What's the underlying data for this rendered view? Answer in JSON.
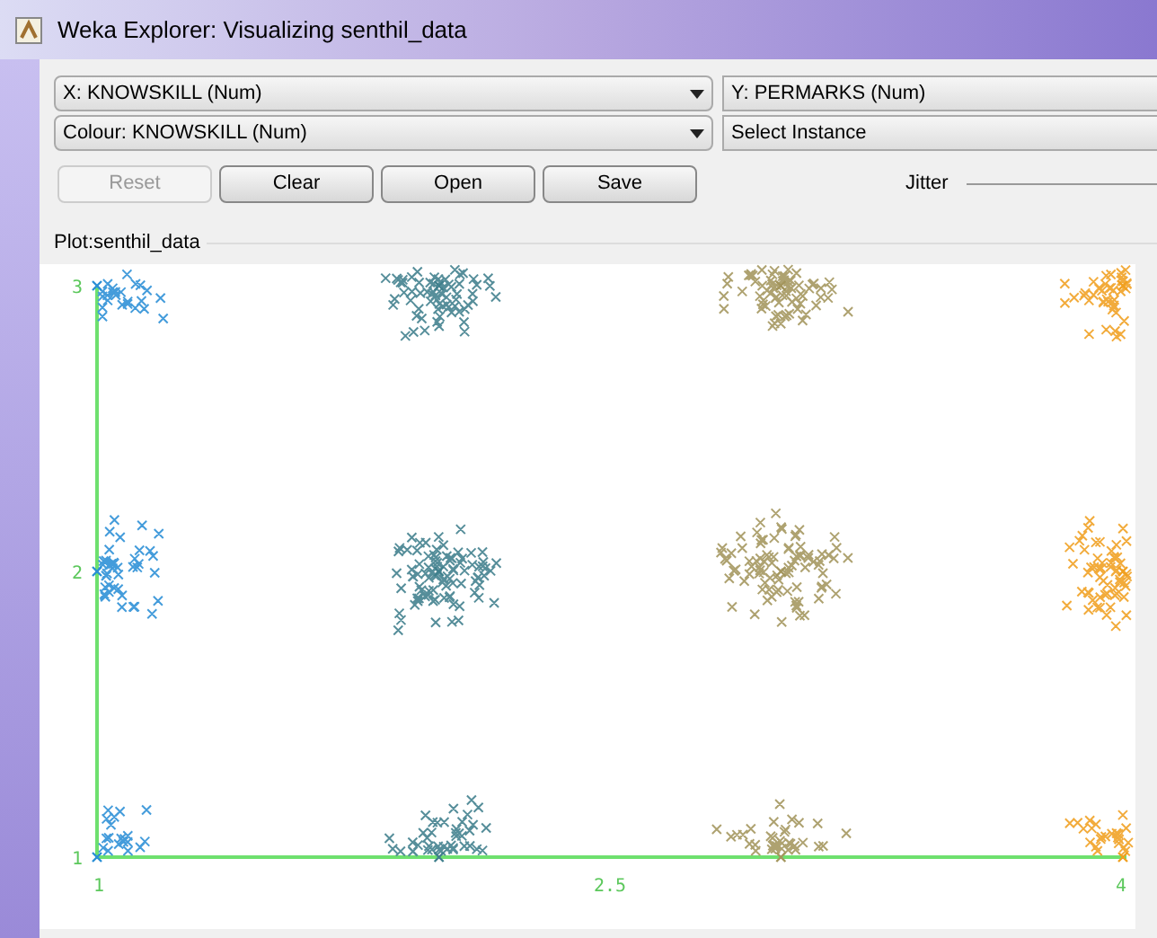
{
  "window": {
    "title": "Weka Explorer: Visualizing senthil_data"
  },
  "x_select": {
    "value": "X: KNOWSKILL (Num)"
  },
  "y_select": {
    "value": "Y: PERMARKS (Num)"
  },
  "colour_select": {
    "value": "Colour: KNOWSKILL (Num)"
  },
  "instance_select": {
    "value": "Select Instance"
  },
  "buttons": [
    {
      "label": "Reset",
      "disabled": true
    },
    {
      "label": "Clear",
      "disabled": false
    },
    {
      "label": "Open",
      "disabled": false
    },
    {
      "label": "Save",
      "disabled": false
    }
  ],
  "jitter": {
    "label": "Jitter"
  },
  "plot": {
    "title": "Plot:senthil_data",
    "chart_data": {
      "type": "scatter",
      "xlim": [
        1,
        4
      ],
      "ylim": [
        1,
        3
      ],
      "xticks": [
        1,
        2.5,
        4
      ],
      "yticks": [
        1,
        2,
        3
      ],
      "series": [
        {
          "color": "#2a8fd6",
          "x": [
            1,
            1,
            1
          ],
          "values": [
            1,
            2,
            3
          ]
        },
        {
          "color": "#3f7f8c",
          "x": [
            2,
            2,
            2
          ],
          "values": [
            1,
            2,
            3
          ]
        },
        {
          "color": "#a3955c",
          "x": [
            3,
            3,
            3
          ],
          "values": [
            1,
            2,
            3
          ]
        },
        {
          "color": "#f0a020",
          "x": [
            4,
            4,
            4
          ],
          "values": [
            1,
            2,
            3
          ]
        }
      ]
    }
  }
}
